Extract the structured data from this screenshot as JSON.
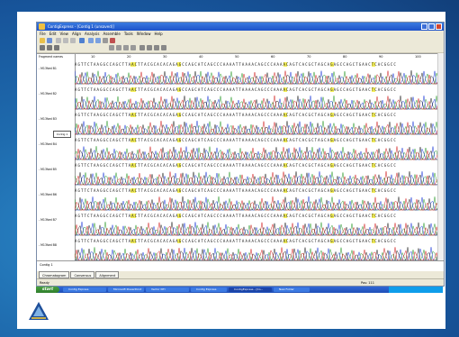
{
  "window": {
    "title": "ContigExpress - [Contig 1 (unsaved)]"
  },
  "menu": [
    "File",
    "Edit",
    "View",
    "Align",
    "Analysis",
    "Assemble",
    "Tools",
    "Window",
    "Help"
  ],
  "left_pane": {
    "root_label": "Fragment names",
    "rows": [
      {
        "label": "- M13fwd B1"
      },
      {
        "label": "- M13fwd B2"
      },
      {
        "label": "- M13fwd B3"
      },
      {
        "label": "- M13fwd B4"
      },
      {
        "label": "- M13fwd B5"
      },
      {
        "label": "- M13fwd B6"
      },
      {
        "label": "- M13fwd B7"
      },
      {
        "label": "- M13fwd B8"
      }
    ],
    "tooltip": "Contig 1"
  },
  "ruler": [
    "10",
    "20",
    "30",
    "40",
    "50",
    "60",
    "70",
    "80",
    "90",
    "100"
  ],
  "sequence": "AGTTCTAAGGCCAGCTTAACTTACGCACACAGAGCCAGCATCAGCCCAAAATTAAAACAGCCCAAAACAGTCACGCTAGCAGAGCCAGCTGAACTCACGGCC",
  "consensus_label": "Contig 1",
  "tabs": [
    "Chromatogram",
    "Consensus",
    "Alignment"
  ],
  "status": {
    "left": "Ready",
    "right": "Pos: 111"
  },
  "taskbar": {
    "start": "start",
    "items": [
      "Contig Express",
      "Microsoft PowerPoint",
      "Vector NTI",
      "Contig Express",
      "ContigExpress - [Co...",
      "New Folder"
    ]
  },
  "colors": {
    "A": "#2a9a2a",
    "C": "#1e3bd8",
    "G": "#222222",
    "T": "#d22020",
    "highlight": "#f5f05a"
  },
  "icons": [
    "logo-icon"
  ]
}
